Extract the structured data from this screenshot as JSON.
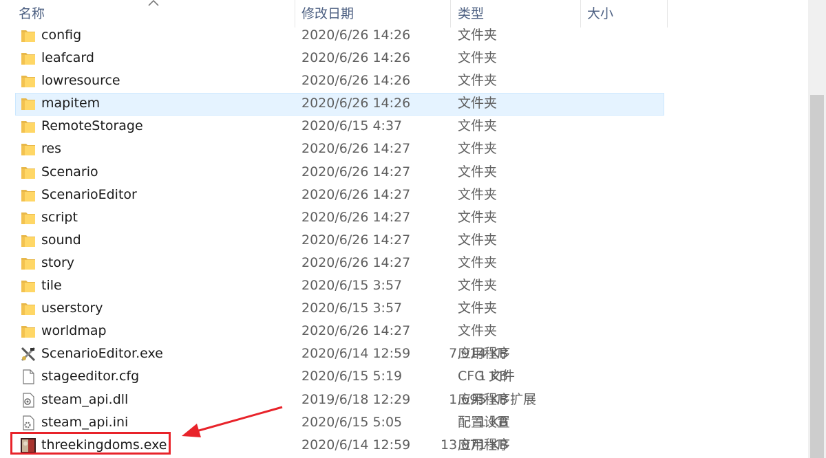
{
  "columns": {
    "name": "名称",
    "date_modified": "修改日期",
    "type": "类型",
    "size": "大小"
  },
  "sort_indicator": "ascending",
  "rows": [
    {
      "name": "config",
      "date": "2020/6/26 14:26",
      "type": "文件夹",
      "size": "",
      "icon": "folder-icon"
    },
    {
      "name": "leafcard",
      "date": "2020/6/26 14:26",
      "type": "文件夹",
      "size": "",
      "icon": "folder-icon"
    },
    {
      "name": "lowresource",
      "date": "2020/6/26 14:26",
      "type": "文件夹",
      "size": "",
      "icon": "folder-icon"
    },
    {
      "name": "mapitem",
      "date": "2020/6/26 14:26",
      "type": "文件夹",
      "size": "",
      "icon": "folder-icon",
      "selected": true
    },
    {
      "name": "RemoteStorage",
      "date": "2020/6/15 4:37",
      "type": "文件夹",
      "size": "",
      "icon": "folder-icon"
    },
    {
      "name": "res",
      "date": "2020/6/26 14:27",
      "type": "文件夹",
      "size": "",
      "icon": "folder-icon"
    },
    {
      "name": "Scenario",
      "date": "2020/6/26 14:27",
      "type": "文件夹",
      "size": "",
      "icon": "folder-icon"
    },
    {
      "name": "ScenarioEditor",
      "date": "2020/6/26 14:27",
      "type": "文件夹",
      "size": "",
      "icon": "folder-icon"
    },
    {
      "name": "script",
      "date": "2020/6/26 14:27",
      "type": "文件夹",
      "size": "",
      "icon": "folder-icon"
    },
    {
      "name": "sound",
      "date": "2020/6/26 14:27",
      "type": "文件夹",
      "size": "",
      "icon": "folder-icon"
    },
    {
      "name": "story",
      "date": "2020/6/26 14:27",
      "type": "文件夹",
      "size": "",
      "icon": "folder-icon"
    },
    {
      "name": "tile",
      "date": "2020/6/15 3:57",
      "type": "文件夹",
      "size": "",
      "icon": "folder-icon"
    },
    {
      "name": "userstory",
      "date": "2020/6/15 3:57",
      "type": "文件夹",
      "size": "",
      "icon": "folder-icon"
    },
    {
      "name": "worldmap",
      "date": "2020/6/26 14:27",
      "type": "文件夹",
      "size": "",
      "icon": "folder-icon"
    },
    {
      "name": "ScenarioEditor.exe",
      "date": "2020/6/14 12:59",
      "type": "应用程序",
      "size": "7,914 KB",
      "icon": "tools-exe-icon"
    },
    {
      "name": "stageeditor.cfg",
      "date": "2020/6/15 5:19",
      "type": "CFG 文件",
      "size": "1 KB",
      "icon": "blank-file-icon"
    },
    {
      "name": "steam_api.dll",
      "date": "2019/6/18 12:29",
      "type": "应用程序扩展",
      "size": "1,695 KB",
      "icon": "dll-file-icon"
    },
    {
      "name": "steam_api.ini",
      "date": "2020/6/15 5:05",
      "type": "配置设置",
      "size": "1 KB",
      "icon": "settings-file-icon"
    },
    {
      "name": "threekingdoms.exe",
      "date": "2020/6/14 12:59",
      "type": "应用程序",
      "size": "13,871 KB",
      "icon": "game-exe-icon",
      "highlighted": true
    }
  ],
  "colors": {
    "selection_bg": "#e5f3ff",
    "annotation_red": "#e8232a",
    "folder_yellow": "#ffd766"
  }
}
